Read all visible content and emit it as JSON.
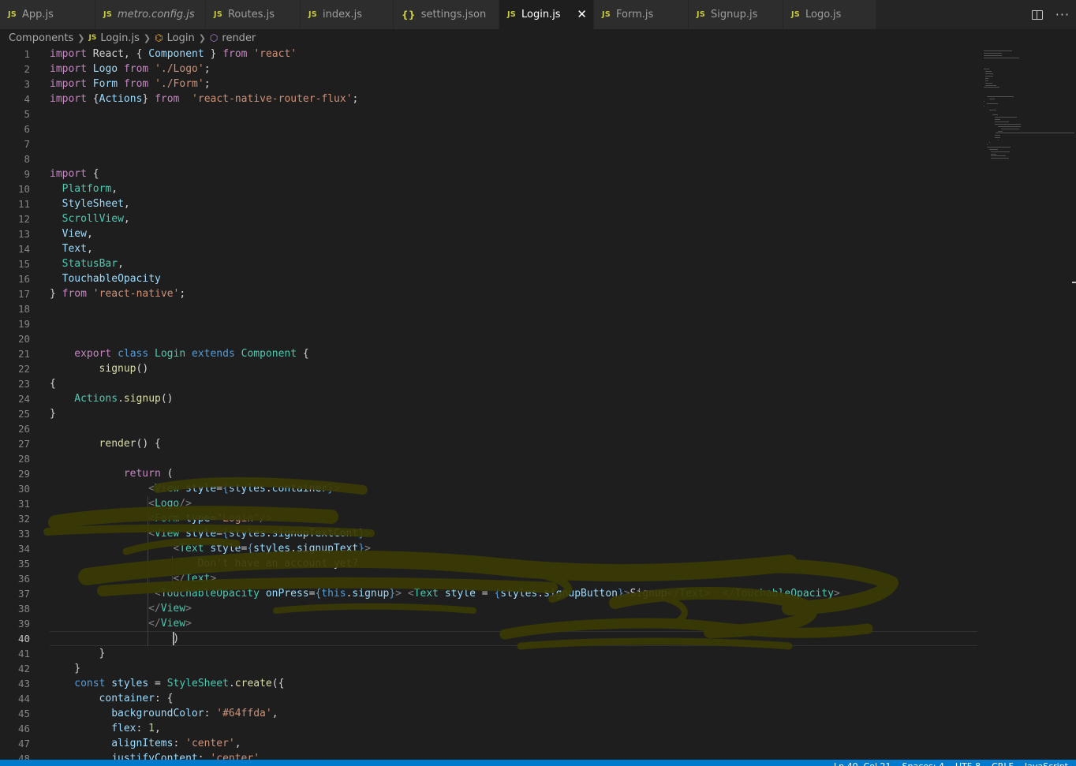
{
  "tabs": [
    {
      "label": "App.js",
      "icon": "js-file-icon",
      "active": false,
      "italic": false
    },
    {
      "label": "metro.config.js",
      "icon": "js-file-icon",
      "active": false,
      "italic": true
    },
    {
      "label": "Routes.js",
      "icon": "js-file-icon",
      "active": false,
      "italic": false
    },
    {
      "label": "index.js",
      "icon": "js-file-icon",
      "active": false,
      "italic": false
    },
    {
      "label": "settings.json",
      "icon": "json-file-icon",
      "active": false,
      "italic": false
    },
    {
      "label": "Login.js",
      "icon": "js-file-icon",
      "active": true,
      "italic": false
    },
    {
      "label": "Form.js",
      "icon": "js-file-icon",
      "active": false,
      "italic": false
    },
    {
      "label": "Signup.js",
      "icon": "js-file-icon",
      "active": false,
      "italic": false
    },
    {
      "label": "Logo.js",
      "icon": "js-file-icon",
      "active": false,
      "italic": false
    }
  ],
  "tab_glyphs": {
    "js": "JS",
    "json": "{}",
    "close": "✕"
  },
  "breadcrumb": {
    "folder": "Components",
    "file": "Login.js",
    "symbol": "Login",
    "method": "render"
  },
  "editor": {
    "cursor_line": 40,
    "lines": [
      {
        "n": 1,
        "indent": 0,
        "tokens": [
          [
            "kw",
            "import"
          ],
          [
            "pun",
            " React, { "
          ],
          [
            "var",
            "Component"
          ],
          [
            "pun",
            " } "
          ],
          [
            "kw",
            "from"
          ],
          [
            "pun",
            " "
          ],
          [
            "str",
            "'react'"
          ]
        ]
      },
      {
        "n": 2,
        "indent": 0,
        "tokens": [
          [
            "kw",
            "import"
          ],
          [
            "pun",
            " "
          ],
          [
            "var",
            "Logo"
          ],
          [
            "pun",
            " "
          ],
          [
            "kw",
            "from"
          ],
          [
            "pun",
            " "
          ],
          [
            "str",
            "'./Logo'"
          ],
          [
            "pun",
            ";"
          ]
        ]
      },
      {
        "n": 3,
        "indent": 0,
        "tokens": [
          [
            "kw",
            "import"
          ],
          [
            "pun",
            " "
          ],
          [
            "var",
            "Form"
          ],
          [
            "pun",
            " "
          ],
          [
            "kw",
            "from"
          ],
          [
            "pun",
            " "
          ],
          [
            "str",
            "'./Form'"
          ],
          [
            "pun",
            ";"
          ]
        ]
      },
      {
        "n": 4,
        "indent": 0,
        "tokens": [
          [
            "kw",
            "import"
          ],
          [
            "pun",
            " {"
          ],
          [
            "var",
            "Actions"
          ],
          [
            "pun",
            "} "
          ],
          [
            "kw",
            "from"
          ],
          [
            "pun",
            "  "
          ],
          [
            "str",
            "'react-native-router-flux'"
          ],
          [
            "pun",
            ";"
          ]
        ]
      },
      {
        "n": 5,
        "indent": 0,
        "tokens": []
      },
      {
        "n": 6,
        "indent": 0,
        "tokens": []
      },
      {
        "n": 7,
        "indent": 0,
        "tokens": []
      },
      {
        "n": 8,
        "indent": 0,
        "tokens": []
      },
      {
        "n": 9,
        "indent": 0,
        "tokens": [
          [
            "kw",
            "import"
          ],
          [
            "pun",
            " {"
          ]
        ]
      },
      {
        "n": 10,
        "indent": 2,
        "tokens": [
          [
            "cls",
            "Platform"
          ],
          [
            "pun",
            ","
          ]
        ]
      },
      {
        "n": 11,
        "indent": 2,
        "tokens": [
          [
            "var",
            "StyleSheet"
          ],
          [
            "pun",
            ","
          ]
        ]
      },
      {
        "n": 12,
        "indent": 2,
        "tokens": [
          [
            "cls",
            "ScrollView"
          ],
          [
            "pun",
            ","
          ]
        ]
      },
      {
        "n": 13,
        "indent": 2,
        "tokens": [
          [
            "var",
            "View"
          ],
          [
            "pun",
            ","
          ]
        ]
      },
      {
        "n": 14,
        "indent": 2,
        "tokens": [
          [
            "var",
            "Text"
          ],
          [
            "pun",
            ","
          ]
        ]
      },
      {
        "n": 15,
        "indent": 2,
        "tokens": [
          [
            "cls",
            "StatusBar"
          ],
          [
            "pun",
            ","
          ]
        ]
      },
      {
        "n": 16,
        "indent": 2,
        "tokens": [
          [
            "var",
            "TouchableOpacity"
          ]
        ]
      },
      {
        "n": 17,
        "indent": 0,
        "tokens": [
          [
            "pun",
            "} "
          ],
          [
            "kw",
            "from"
          ],
          [
            "pun",
            " "
          ],
          [
            "str",
            "'react-native'"
          ],
          [
            "pun",
            ";"
          ]
        ]
      },
      {
        "n": 18,
        "indent": 0,
        "tokens": []
      },
      {
        "n": 19,
        "indent": 0,
        "tokens": []
      },
      {
        "n": 20,
        "indent": 0,
        "tokens": []
      },
      {
        "n": 21,
        "indent": 4,
        "tokens": [
          [
            "kw",
            "export"
          ],
          [
            "pun",
            " "
          ],
          [
            "kw2",
            "class"
          ],
          [
            "pun",
            " "
          ],
          [
            "cls",
            "Login"
          ],
          [
            "pun",
            " "
          ],
          [
            "kw2",
            "extends"
          ],
          [
            "pun",
            " "
          ],
          [
            "cls",
            "Component"
          ],
          [
            "pun",
            " {"
          ]
        ]
      },
      {
        "n": 22,
        "indent": 8,
        "tokens": [
          [
            "fn",
            "signup"
          ],
          [
            "pun",
            "()"
          ]
        ]
      },
      {
        "n": 23,
        "indent": 0,
        "tokens": [
          [
            "pun",
            "{"
          ]
        ]
      },
      {
        "n": 24,
        "indent": 4,
        "tokens": [
          [
            "cls",
            "Actions"
          ],
          [
            "pun",
            "."
          ],
          [
            "fn",
            "signup"
          ],
          [
            "pun",
            "()"
          ]
        ]
      },
      {
        "n": 25,
        "indent": 0,
        "tokens": [
          [
            "pun",
            "}"
          ]
        ]
      },
      {
        "n": 26,
        "indent": 0,
        "tokens": []
      },
      {
        "n": 27,
        "indent": 8,
        "tokens": [
          [
            "fn",
            "render"
          ],
          [
            "pun",
            "() {"
          ]
        ]
      },
      {
        "n": 28,
        "indent": 0,
        "tokens": []
      },
      {
        "n": 29,
        "indent": 12,
        "tokens": [
          [
            "kw",
            "return"
          ],
          [
            "pun",
            " ("
          ]
        ]
      },
      {
        "n": 30,
        "indent": 16,
        "tokens": [
          [
            "tag",
            "<"
          ],
          [
            "cls",
            "View"
          ],
          [
            "pun",
            " "
          ],
          [
            "var",
            "style"
          ],
          [
            "pun",
            "="
          ],
          [
            "kw2",
            "{"
          ],
          [
            "var",
            "styles"
          ],
          [
            "pun",
            "."
          ],
          [
            "var",
            "container"
          ],
          [
            "kw2",
            "}"
          ],
          [
            "tag",
            ">"
          ]
        ]
      },
      {
        "n": 31,
        "indent": 16,
        "tokens": [
          [
            "tag",
            "<"
          ],
          [
            "cls",
            "Logo"
          ],
          [
            "tag",
            "/>"
          ]
        ]
      },
      {
        "n": 32,
        "indent": 16,
        "tokens": [
          [
            "tag",
            "<"
          ],
          [
            "cls",
            "Form"
          ],
          [
            "pun",
            " "
          ],
          [
            "var",
            "type"
          ],
          [
            "pun",
            "="
          ],
          [
            "str",
            "\"Login\""
          ],
          [
            "tag",
            "/>"
          ]
        ]
      },
      {
        "n": 33,
        "indent": 16,
        "tokens": [
          [
            "tag",
            "<"
          ],
          [
            "cls",
            "View"
          ],
          [
            "pun",
            " "
          ],
          [
            "var",
            "style"
          ],
          [
            "pun",
            "="
          ],
          [
            "kw2",
            "{"
          ],
          [
            "var",
            "styles"
          ],
          [
            "pun",
            "."
          ],
          [
            "var",
            "signupTextCont"
          ],
          [
            "kw2",
            "}"
          ],
          [
            "tag",
            ">"
          ]
        ]
      },
      {
        "n": 34,
        "indent": 20,
        "tokens": [
          [
            "tag",
            "<"
          ],
          [
            "cls",
            "Text"
          ],
          [
            "pun",
            " "
          ],
          [
            "var",
            "style"
          ],
          [
            "pun",
            "="
          ],
          [
            "kw2",
            "{"
          ],
          [
            "var",
            "styles"
          ],
          [
            "pun",
            "."
          ],
          [
            "var",
            "signupText"
          ],
          [
            "kw2",
            "}"
          ],
          [
            "tag",
            ">"
          ]
        ]
      },
      {
        "n": 35,
        "indent": 24,
        "tokens": [
          [
            "pun",
            "Don't have an account yet?"
          ]
        ]
      },
      {
        "n": 36,
        "indent": 20,
        "tokens": [
          [
            "tag",
            "</"
          ],
          [
            "cls",
            "Text"
          ],
          [
            "tag",
            ">"
          ]
        ]
      },
      {
        "n": 37,
        "indent": 17,
        "tokens": [
          [
            "tag",
            "<"
          ],
          [
            "cls",
            "TouchableOpacity"
          ],
          [
            "pun",
            " "
          ],
          [
            "var",
            "onPress"
          ],
          [
            "pun",
            "="
          ],
          [
            "kw2",
            "{this"
          ],
          [
            "pun",
            "."
          ],
          [
            "var",
            "signup"
          ],
          [
            "kw2",
            "}"
          ],
          [
            "tag",
            ">"
          ],
          [
            "pun",
            " "
          ],
          [
            "tag",
            "<"
          ],
          [
            "cls",
            "Text"
          ],
          [
            "pun",
            " "
          ],
          [
            "var",
            "style"
          ],
          [
            "pun",
            " = "
          ],
          [
            "kw2",
            "{"
          ],
          [
            "var",
            "styles"
          ],
          [
            "pun",
            "."
          ],
          [
            "var",
            "signupButton"
          ],
          [
            "kw2",
            "}"
          ],
          [
            "tag",
            ">"
          ],
          [
            "pun",
            "Signup"
          ],
          [
            "tag",
            "</"
          ],
          [
            "cls",
            "Text"
          ],
          [
            "tag",
            ">"
          ],
          [
            "pun",
            "  "
          ],
          [
            "tag",
            "</"
          ],
          [
            "cls",
            "TouchableOpacity"
          ],
          [
            "tag",
            ">"
          ]
        ]
      },
      {
        "n": 38,
        "indent": 16,
        "tokens": [
          [
            "tag",
            "</"
          ],
          [
            "cls",
            "View"
          ],
          [
            "tag",
            ">"
          ]
        ]
      },
      {
        "n": 39,
        "indent": 16,
        "tokens": [
          [
            "tag",
            "</"
          ],
          [
            "cls",
            "View"
          ],
          [
            "tag",
            ">"
          ]
        ]
      },
      {
        "n": 40,
        "indent": 20,
        "tokens": [
          [
            "pun",
            ")"
          ]
        ]
      },
      {
        "n": 41,
        "indent": 8,
        "tokens": [
          [
            "pun",
            "}"
          ]
        ]
      },
      {
        "n": 42,
        "indent": 4,
        "tokens": [
          [
            "pun",
            "}"
          ]
        ]
      },
      {
        "n": 43,
        "indent": 4,
        "tokens": [
          [
            "kw2",
            "const"
          ],
          [
            "pun",
            " "
          ],
          [
            "var",
            "styles"
          ],
          [
            "pun",
            " = "
          ],
          [
            "cls",
            "StyleSheet"
          ],
          [
            "pun",
            "."
          ],
          [
            "fn",
            "create"
          ],
          [
            "pun",
            "({"
          ]
        ]
      },
      {
        "n": 44,
        "indent": 8,
        "tokens": [
          [
            "var",
            "container"
          ],
          [
            "pun",
            ": {"
          ]
        ]
      },
      {
        "n": 45,
        "indent": 10,
        "tokens": [
          [
            "var",
            "backgroundColor"
          ],
          [
            "pun",
            ": "
          ],
          [
            "str",
            "'#64ffda'"
          ],
          [
            "pun",
            ","
          ]
        ]
      },
      {
        "n": 46,
        "indent": 10,
        "tokens": [
          [
            "var",
            "flex"
          ],
          [
            "pun",
            ": "
          ],
          [
            "num",
            "1"
          ],
          [
            "pun",
            ","
          ]
        ]
      },
      {
        "n": 47,
        "indent": 10,
        "tokens": [
          [
            "var",
            "alignItems"
          ],
          [
            "pun",
            ": "
          ],
          [
            "str",
            "'center'"
          ],
          [
            "pun",
            ","
          ]
        ]
      },
      {
        "n": 48,
        "indent": 10,
        "tokens": [
          [
            "var",
            "justifyContent"
          ],
          [
            "pun",
            ": "
          ],
          [
            "str",
            "'center'"
          ],
          [
            "pun",
            ","
          ]
        ]
      }
    ]
  },
  "status": {
    "items": [
      "Ln 40, Col 21",
      "Spaces: 4",
      "UTF-8",
      "CRLF",
      "JavaScript"
    ]
  },
  "colors": {
    "editor_bg": "#1e1e1e",
    "tabbar_bg": "#252526",
    "status_bg": "#007acc",
    "scribble": "#3a3a00"
  },
  "icons": {
    "split_editor": "split-editor-icon",
    "more": "more-actions-icon",
    "symbol_class": "class-symbol-icon",
    "symbol_method": "method-cube-icon"
  }
}
